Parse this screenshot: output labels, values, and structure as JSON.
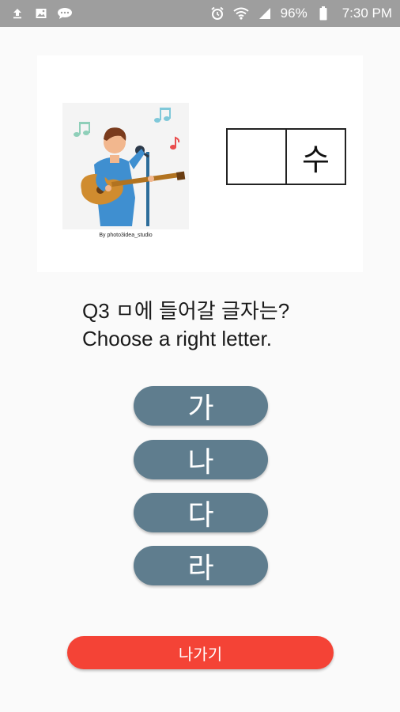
{
  "status_bar": {
    "battery": "96%",
    "time": "7:30 PM",
    "icons": [
      "upload-icon",
      "image-icon",
      "chat-icon",
      "alarm-icon",
      "wifi-icon",
      "signal-icon",
      "battery-icon"
    ]
  },
  "illustration": {
    "credit": "By photo3idea_studio",
    "icon": "guitar-singer-illustration"
  },
  "word_puzzle": {
    "cells": [
      "",
      "수"
    ]
  },
  "question": {
    "line1": "Q3 ㅁ에 들어갈 글자는?",
    "line2": "Choose a right letter."
  },
  "options": [
    "가",
    "나",
    "다",
    "라"
  ],
  "exit_label": "나가기",
  "colors": {
    "status_bar": "#9e9e9e",
    "option_button": "#5f7d8e",
    "exit_button": "#f44336",
    "background": "#fafafa"
  }
}
